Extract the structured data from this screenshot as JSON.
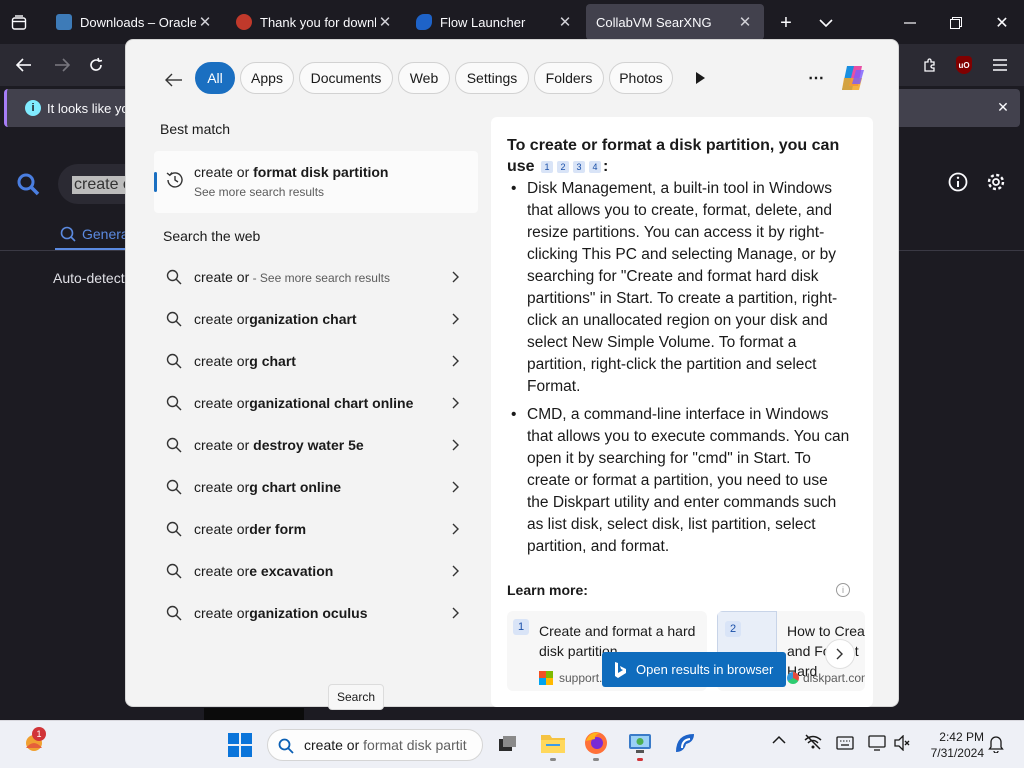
{
  "browser": {
    "tabs": [
      {
        "label": "Downloads – Oracle VM",
        "color": "#3d7bb8"
      },
      {
        "label": "Thank you for downloading",
        "color": "#c0392b"
      },
      {
        "label": "Flow Launcher",
        "color": "#1e63c8"
      },
      {
        "label": "CollabVM SearXNG",
        "color": "#42414d"
      }
    ],
    "infobar_text": "It looks like you",
    "infobar_icon": "info-icon"
  },
  "page": {
    "search_value": "create o",
    "tab_general": "Genera",
    "auto_detect": "Auto-detect"
  },
  "flyout": {
    "filters": [
      "All",
      "Apps",
      "Documents",
      "Web",
      "Settings",
      "Folders",
      "Photos"
    ],
    "best_match_heading": "Best match",
    "best_match": {
      "prefix": "create or ",
      "bold": "format disk partition",
      "subtitle": "See more search results"
    },
    "web_heading": "Search the web",
    "suggestions": [
      {
        "typed": "create or",
        "rest": "",
        "hint": " - See more search results"
      },
      {
        "typed": "create or",
        "rest": "ganization chart",
        "hint": ""
      },
      {
        "typed": "create or",
        "rest": "g chart",
        "hint": ""
      },
      {
        "typed": "create or",
        "rest": "ganizational chart online",
        "hint": ""
      },
      {
        "typed": "create or ",
        "rest": "destroy water 5e",
        "hint": ""
      },
      {
        "typed": "create or",
        "rest": "g chart online",
        "hint": ""
      },
      {
        "typed": "create or",
        "rest": "der form",
        "hint": ""
      },
      {
        "typed": "create or",
        "rest": "e excavation",
        "hint": ""
      },
      {
        "typed": "create or",
        "rest": "ganization oculus",
        "hint": ""
      }
    ],
    "answer": {
      "title": "To create or format a disk partition, you can use",
      "citations": [
        "1",
        "2",
        "3",
        "4"
      ],
      "title_end": ":",
      "bullets": [
        "Disk Management, a built-in tool in Windows that allows you to create, format, delete, and resize partitions. You can access it by right-clicking This PC and selecting Manage, or by searching for \"Create and format hard disk partitions\" in Start. To create a partition, right-click an unallocated region on your disk and select New Simple Volume. To format a partition, right-click the partition and select Format.",
        "CMD, a command-line interface in Windows that allows you to execute commands. You can open it by searching for \"cmd\" in Start. To create or format a partition, you need to use the Diskpart utility and enter commands such as list disk, select disk, list partition, select partition, and format."
      ],
      "learn_more": "Learn more:",
      "cards": [
        {
          "num": "1",
          "title": "Create and format a hard disk partition",
          "source": "support."
        },
        {
          "num": "2",
          "title": "How to Create and Format Hard",
          "source": "diskpart.com"
        }
      ],
      "open_button": "Open results in browser"
    }
  },
  "tooltip": "Search",
  "taskbar": {
    "search_typed": "create or",
    "search_rest": " format disk partit",
    "time": "2:42 PM",
    "date": "7/31/2024",
    "weather_badge": "1"
  }
}
